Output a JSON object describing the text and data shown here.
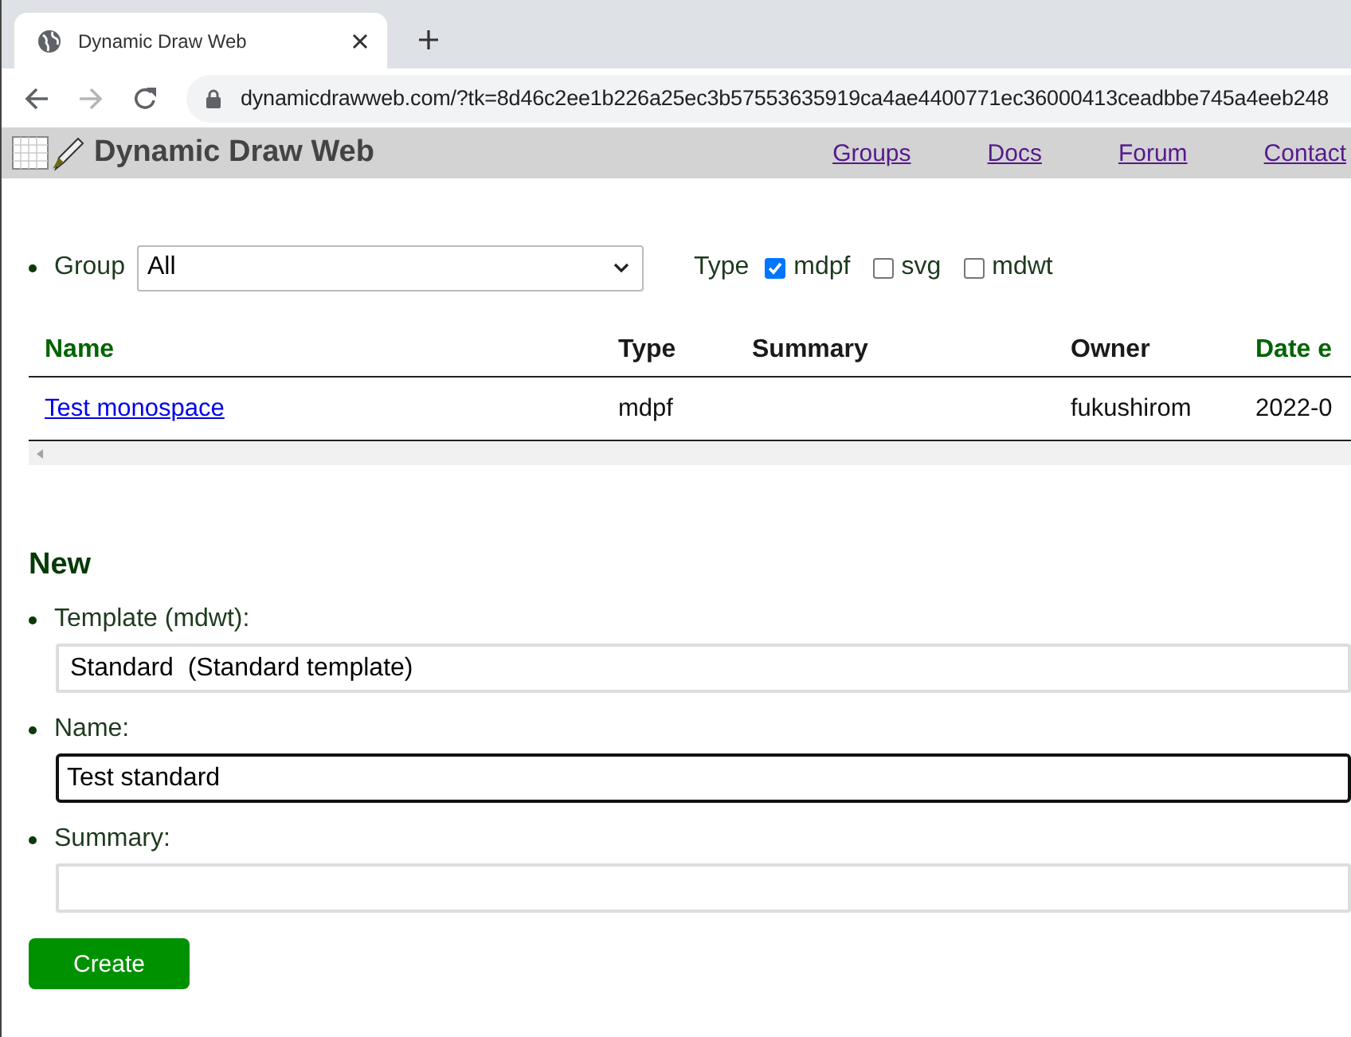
{
  "browser": {
    "tab_title": "Dynamic Draw Web",
    "url": "dynamicdrawweb.com/?tk=8d46c2ee1b226a25ec3b57553635919ca4ae4400771ec36000413ceadbbe745a4eeb248"
  },
  "site": {
    "title": "Dynamic Draw Web",
    "nav": [
      "Groups",
      "Docs",
      "Forum",
      "Contact"
    ]
  },
  "filter": {
    "group_label": "Group",
    "group_value": "All",
    "type_label": "Type",
    "types": [
      {
        "label": "mdpf",
        "checked": true
      },
      {
        "label": "svg",
        "checked": false
      },
      {
        "label": "mdwt",
        "checked": false
      }
    ]
  },
  "table": {
    "columns": [
      {
        "label": "Name",
        "sortable": true
      },
      {
        "label": "Type",
        "sortable": false
      },
      {
        "label": "Summary",
        "sortable": false
      },
      {
        "label": "Owner",
        "sortable": false
      },
      {
        "label": "Date e",
        "sortable": true
      }
    ],
    "rows": [
      {
        "name": "Test monospace",
        "type": "mdpf",
        "owner": "fukushirom",
        "column_5": "2022-0"
      }
    ]
  },
  "new_form": {
    "heading": "New",
    "fields": [
      {
        "kind": "select",
        "label": "Template (mdwt):",
        "value": "Standard  (Standard template)",
        "focused": false
      },
      {
        "kind": "text",
        "label": "Name:",
        "value": "Test standard",
        "focused": true
      },
      {
        "kind": "text",
        "label": "Summary:",
        "focused": false
      }
    ],
    "submit": "Create"
  }
}
